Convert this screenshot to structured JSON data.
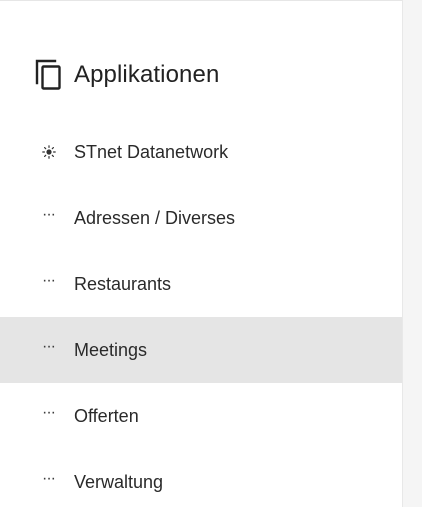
{
  "header": {
    "icon": "copy-icon",
    "title": "Applikationen"
  },
  "menu": {
    "active_item": "Meetings",
    "items": [
      {
        "label": "STnet Datanetwork",
        "icon": "sun-icon"
      },
      {
        "label": "Adressen / Diverses",
        "icon": "ellipsis-icon"
      },
      {
        "label": "Restaurants",
        "icon": "ellipsis-icon"
      },
      {
        "label": "Meetings",
        "icon": "ellipsis-icon"
      },
      {
        "label": "Offerten",
        "icon": "ellipsis-icon"
      },
      {
        "label": "Verwaltung",
        "icon": "ellipsis-icon"
      }
    ]
  },
  "colors": {
    "active_background": "#e5e5e5",
    "text": "#2a2a2a",
    "right_pane": "#f5f5f5"
  }
}
